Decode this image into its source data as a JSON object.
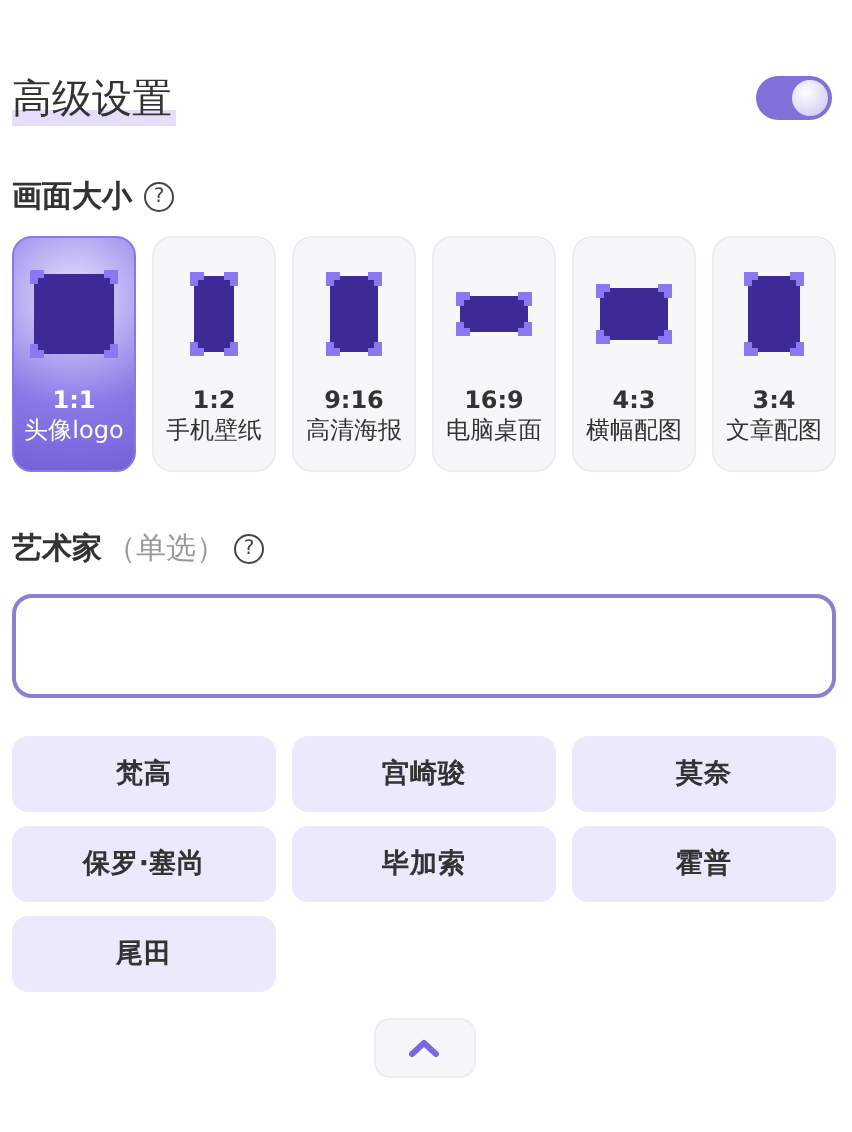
{
  "header": {
    "title": "高级设置",
    "toggle_on": true
  },
  "size_section": {
    "label": "画面大小",
    "help": "?",
    "options": [
      {
        "kind": "square",
        "ratio": "1:1",
        "name": "头像logo",
        "selected": true
      },
      {
        "kind": "tall",
        "ratio": "1:2",
        "name": "手机壁纸",
        "selected": false
      },
      {
        "kind": "portrait",
        "ratio": "9:16",
        "name": "高清海报",
        "selected": false
      },
      {
        "kind": "wide",
        "ratio": "16:9",
        "name": "电脑桌面",
        "selected": false
      },
      {
        "kind": "landscape",
        "ratio": "4:3",
        "name": "横幅配图",
        "selected": false
      },
      {
        "kind": "upright",
        "ratio": "3:4",
        "name": "文章配图",
        "selected": false
      }
    ]
  },
  "artist_section": {
    "label": "艺术家",
    "note": "（单选）",
    "help": "?",
    "artists": [
      {
        "name": "梵高",
        "selected": false
      },
      {
        "name": "宫崎骏",
        "selected": false
      },
      {
        "name": "莫奈",
        "selected": false
      },
      {
        "name": "保罗·塞尚",
        "selected": false
      },
      {
        "name": "毕加索",
        "selected": false
      },
      {
        "name": "霍普",
        "selected": false
      },
      {
        "name": "尾田",
        "selected": false
      }
    ]
  }
}
